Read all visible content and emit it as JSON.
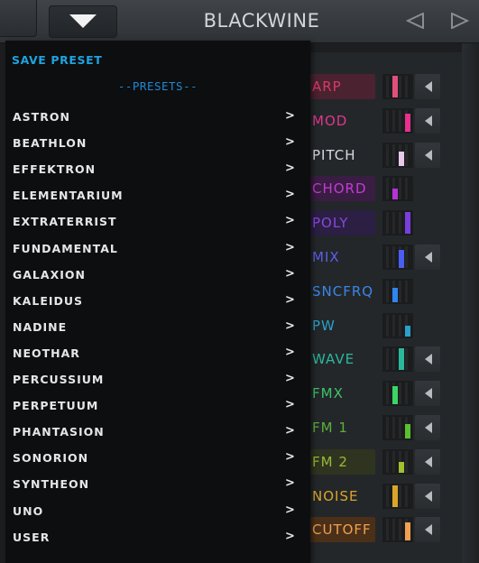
{
  "header": {
    "preset_name": "BLACKWINE",
    "menu_toggle_icon": "triangle-down-icon",
    "prev_icon": "triangle-left-icon",
    "next_icon": "triangle-right-icon"
  },
  "menu": {
    "save_label": "SAVE PRESET",
    "presets_header": "--PRESETS--",
    "chevron": ">",
    "items": [
      {
        "label": "ASTRON"
      },
      {
        "label": "BEATHLON"
      },
      {
        "label": "EFFEKTRON"
      },
      {
        "label": "ELEMENTARIUM"
      },
      {
        "label": "EXTRATERRIST"
      },
      {
        "label": "FUNDAMENTAL"
      },
      {
        "label": "GALAXION"
      },
      {
        "label": "KALEIDUS"
      },
      {
        "label": "NADINE"
      },
      {
        "label": "NEOTHAR"
      },
      {
        "label": "PERCUSSIUM"
      },
      {
        "label": "PERPETUUM"
      },
      {
        "label": "PHANTASION"
      },
      {
        "label": "SONORION"
      },
      {
        "label": "SYNTHEON"
      },
      {
        "label": "UNO"
      },
      {
        "label": "USER"
      }
    ]
  },
  "modules": [
    {
      "label": "ARP",
      "color": "#d63a6a",
      "bg": "#4a2230",
      "meter_color": "#e0507a",
      "has_arrow": true
    },
    {
      "label": "MOD",
      "color": "#e0368e",
      "bg": "",
      "meter_color": "#e8308c",
      "has_arrow": true
    },
    {
      "label": "PITCH",
      "color": "#d9d9e6",
      "bg": "",
      "meter_color": "#e8c8e8",
      "has_arrow": true
    },
    {
      "label": "CHORD",
      "color": "#c23bd6",
      "bg": "#3a1d42",
      "meter_color": "#b434d8",
      "has_arrow": false
    },
    {
      "label": "POLY",
      "color": "#8a46dc",
      "bg": "#2b1f44",
      "meter_color": "#7a3edc",
      "has_arrow": false
    },
    {
      "label": "MIX",
      "color": "#5c5ee8",
      "bg": "",
      "meter_color": "#4a5ef0",
      "has_arrow": true
    },
    {
      "label": "SNCFRQ",
      "color": "#3a86e8",
      "bg": "",
      "meter_color": "#2f86ee",
      "has_arrow": false
    },
    {
      "label": "PW",
      "color": "#2aa0c8",
      "bg": "",
      "meter_color": "#2aa0c8",
      "has_arrow": false
    },
    {
      "label": "WAVE",
      "color": "#2ab89c",
      "bg": "",
      "meter_color": "#2ab89c",
      "has_arrow": true
    },
    {
      "label": "FMX",
      "color": "#3cc46a",
      "bg": "",
      "meter_color": "#3cd464",
      "has_arrow": true
    },
    {
      "label": "FM 1",
      "color": "#5ab03a",
      "bg": "",
      "meter_color": "#5ac030",
      "has_arrow": true
    },
    {
      "label": "FM 2",
      "color": "#9ab83a",
      "bg": "#2e3420",
      "meter_color": "#a0c030",
      "has_arrow": true
    },
    {
      "label": "NOISE",
      "color": "#d9a62a",
      "bg": "",
      "meter_color": "#d9a62a",
      "has_arrow": true
    },
    {
      "label": "CUTOFF",
      "color": "#f0a050",
      "bg": "#4a3018",
      "meter_color": "#f0a050",
      "has_arrow": true
    }
  ]
}
